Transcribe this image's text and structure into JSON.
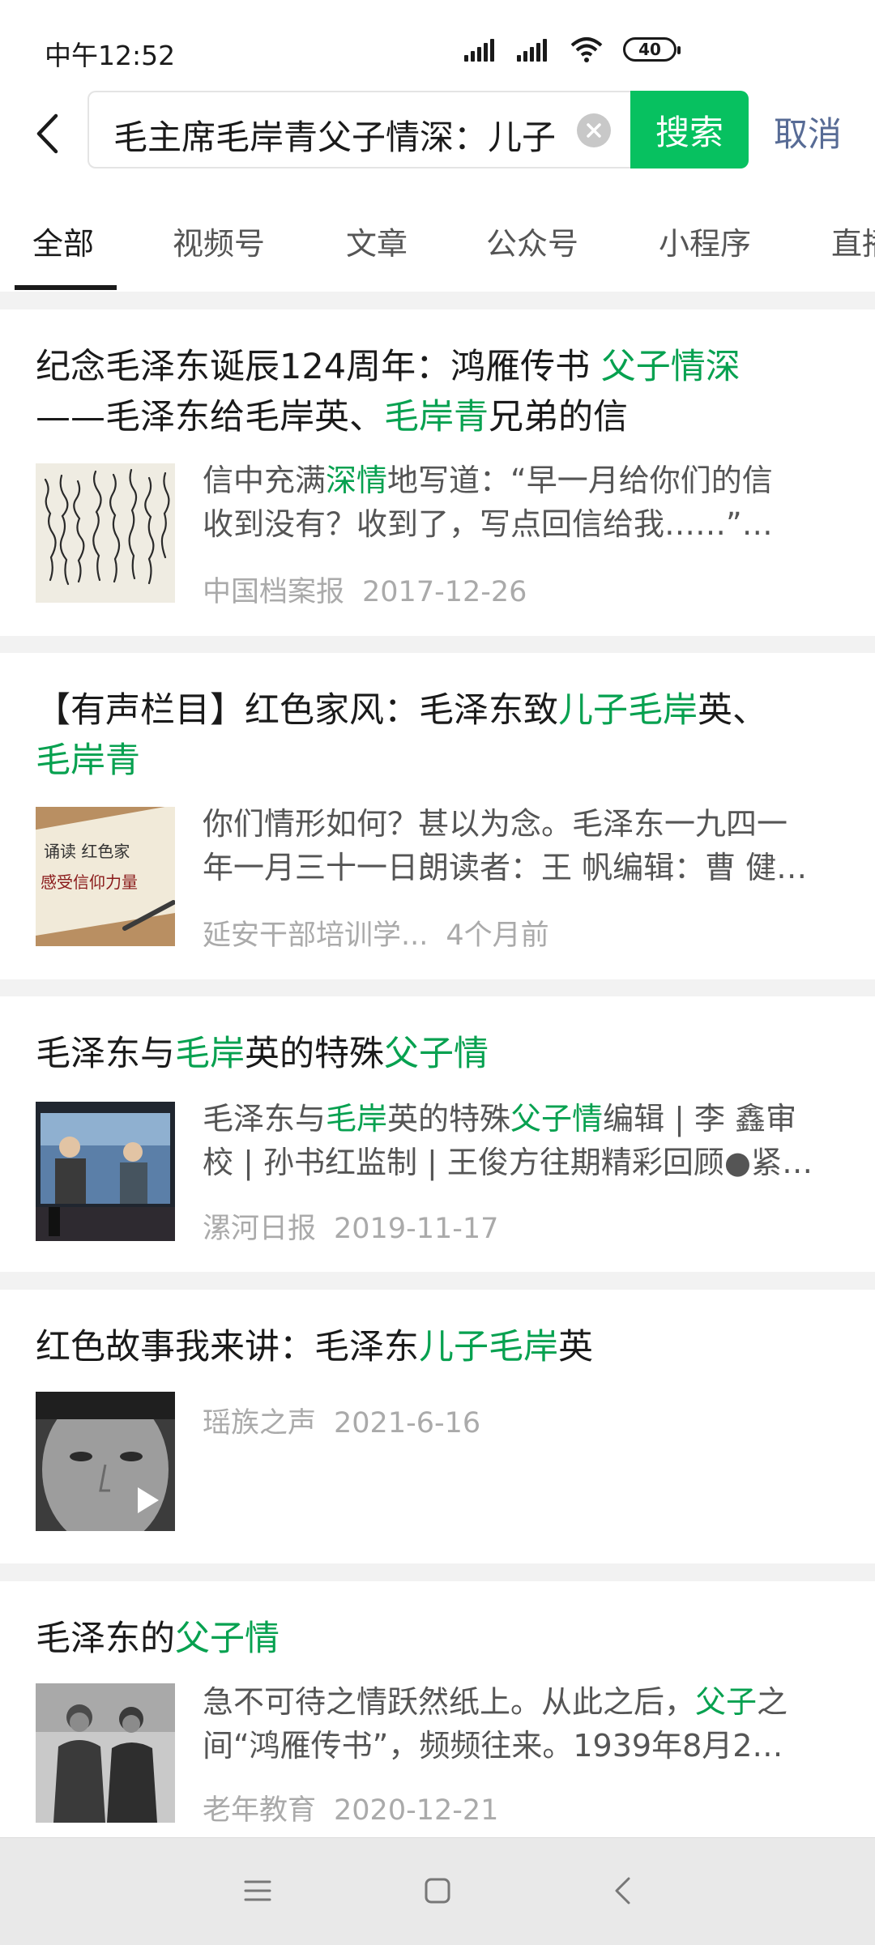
{
  "status_bar": {
    "time": "中午12:52",
    "battery": "40"
  },
  "search": {
    "query": "毛主席毛岸青父子情深：儿子",
    "search_label": "搜索",
    "cancel_label": "取消"
  },
  "tabs": [
    "全部",
    "视频号",
    "文章",
    "公众号",
    "小程序",
    "直播"
  ],
  "colors": {
    "accent": "#07c160",
    "highlight": "#07a150",
    "link": "#576b95"
  },
  "results": [
    {
      "title_l1_a": "纪念毛泽东诞辰124周年：鸿雁传书 ",
      "title_l1_b": "父子情深",
      "title_l2_a": "——毛泽东给毛岸英、",
      "title_l2_b": "毛岸青",
      "title_l2_c": "兄弟的信",
      "snippet_l1_a": "信中充满",
      "snippet_l1_b": "深情",
      "snippet_l1_c": "地写道：“早一月给你们的信",
      "snippet_l2": "收到没有？收到了，写点回信给我……”…",
      "source": "中国档案报",
      "date": "2017-12-26"
    },
    {
      "title_l1_a": "【有声栏目】红色家风：毛泽东致",
      "title_l1_b": "儿子毛岸",
      "title_l1_c": "英、",
      "title_l2_b": "毛岸青",
      "snippet_l1": "你们情形如何？甚以为念。毛泽东一九四一",
      "snippet_l2": "年一月三十一日朗读者：王 帆编辑：曹 健…",
      "source": "延安干部培训学...",
      "date": "4个月前",
      "thumb_text_1": "诵读 红色家",
      "thumb_text_2": "感受信仰力量"
    },
    {
      "title_a": "毛泽东与",
      "title_b": "毛岸",
      "title_c": "英的特殊",
      "title_d": "父子情",
      "snippet_l1_a": "毛泽东与",
      "snippet_l1_b": "毛岸",
      "snippet_l1_c": "英的特殊",
      "snippet_l1_d": "父子情",
      "snippet_l1_e": "编辑 | 李 鑫审",
      "snippet_l2": "校 | 孙书红监制 | 王俊方往期精彩回顾●紧…",
      "source": "漯河日报",
      "date": "2019-11-17"
    },
    {
      "title_a": "红色故事我来讲：毛泽东",
      "title_b": "儿子毛岸",
      "title_c": "英",
      "source": "瑶族之声",
      "date": "2021-6-16"
    },
    {
      "title_a": "毛泽东的",
      "title_b": "父子情",
      "snippet_l1_a": "急不可待之情跃然纸上。从此之后，",
      "snippet_l1_b": "父子",
      "snippet_l1_c": "之",
      "snippet_l2": "间“鸿雁传书”，频频往来。1939年8月2…",
      "source": "老年教育",
      "date": "2020-12-21"
    }
  ]
}
